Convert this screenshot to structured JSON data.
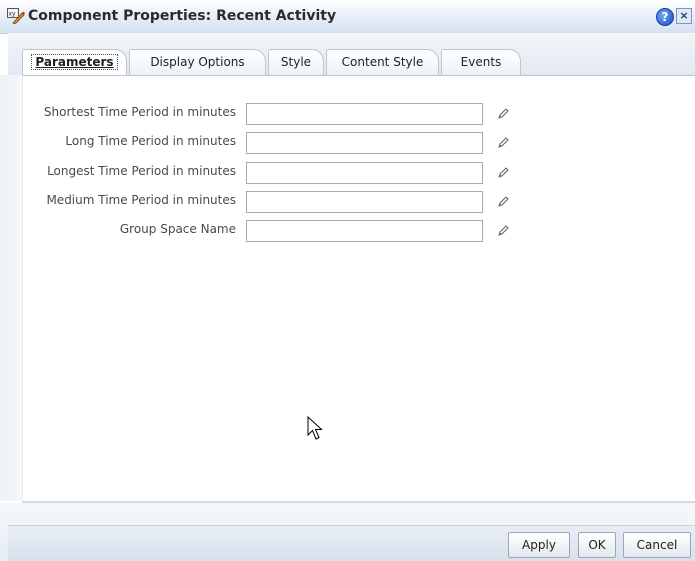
{
  "dialog": {
    "title": "Component Properties: Recent Activity",
    "help_label": "?",
    "close_label": "×"
  },
  "tabs": [
    {
      "label": "Parameters",
      "active": true
    },
    {
      "label": "Display Options",
      "active": false
    },
    {
      "label": "Style",
      "active": false
    },
    {
      "label": "Content Style",
      "active": false
    },
    {
      "label": "Events",
      "active": false
    }
  ],
  "parameters": [
    {
      "label": "Shortest Time Period in minutes",
      "value": "",
      "edit_icon": "pencil-icon"
    },
    {
      "label": "Long Time Period in minutes",
      "value": "",
      "edit_icon": "pencil-icon"
    },
    {
      "label": "Longest Time Period in minutes",
      "value": "",
      "edit_icon": "pencil-icon"
    },
    {
      "label": "Medium Time Period in minutes",
      "value": "",
      "edit_icon": "pencil-icon"
    },
    {
      "label": "Group Space Name",
      "value": "",
      "edit_icon": "pencil-icon"
    }
  ],
  "footer": {
    "apply_label": "Apply",
    "ok_label": "OK",
    "cancel_label": "Cancel"
  }
}
